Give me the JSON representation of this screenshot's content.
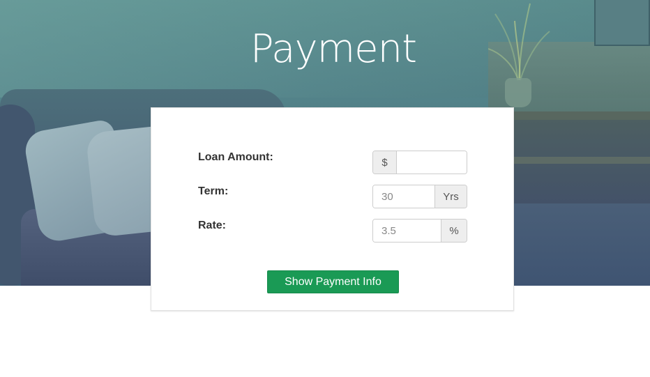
{
  "header": {
    "title": "Payment"
  },
  "form": {
    "loan_amount": {
      "label": "Loan Amount:",
      "prefix": "$",
      "value": "",
      "placeholder": ""
    },
    "term": {
      "label": "Term:",
      "placeholder": "30",
      "suffix": "Yrs"
    },
    "rate": {
      "label": "Rate:",
      "placeholder": "3.5",
      "suffix": "%"
    },
    "submit_label": "Show Payment Info"
  },
  "colors": {
    "button": "#1a9a55",
    "hero_overlay": "#4f7d86"
  }
}
